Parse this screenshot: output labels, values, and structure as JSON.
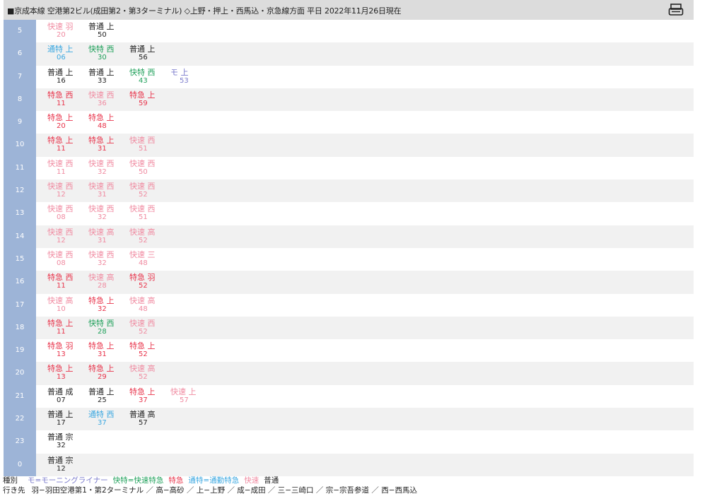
{
  "header": {
    "title": "■京成本線 空港第2ビル(成田第2・第3ターミナル) ◇上野・押上・西馬込・京急線方面 平日 2022年11月26日現在",
    "print_icon": "printer-icon"
  },
  "colors": {
    "moning": "#7b7bcc",
    "kaitoku": "#1fa05a",
    "tokkyu": "#e8334a",
    "tsukin": "#3aa7e0",
    "kaisoku": "#f08aa0",
    "futsu": "#222222",
    "hour_bg": "#9db4d7"
  },
  "rows": [
    {
      "hour": "5",
      "trains": [
        {
          "type": "快速",
          "dest": "羽",
          "min": "20",
          "kind": "kaisoku"
        },
        {
          "type": "普通",
          "dest": "上",
          "min": "50",
          "kind": "futsu"
        }
      ]
    },
    {
      "hour": "6",
      "trains": [
        {
          "type": "通特",
          "dest": "上",
          "min": "06",
          "kind": "tsukin"
        },
        {
          "type": "快特",
          "dest": "西",
          "min": "30",
          "kind": "kaitoku"
        },
        {
          "type": "普通",
          "dest": "上",
          "min": "56",
          "kind": "futsu"
        }
      ]
    },
    {
      "hour": "7",
      "trains": [
        {
          "type": "普通",
          "dest": "上",
          "min": "16",
          "kind": "futsu"
        },
        {
          "type": "普通",
          "dest": "上",
          "min": "33",
          "kind": "futsu"
        },
        {
          "type": "快特",
          "dest": "西",
          "min": "43",
          "kind": "kaitoku"
        },
        {
          "type": "モ",
          "dest": "上",
          "min": "53",
          "kind": "moning"
        }
      ]
    },
    {
      "hour": "8",
      "trains": [
        {
          "type": "特急",
          "dest": "西",
          "min": "11",
          "kind": "tokkyu"
        },
        {
          "type": "快速",
          "dest": "西",
          "min": "36",
          "kind": "kaisoku"
        },
        {
          "type": "特急",
          "dest": "上",
          "min": "59",
          "kind": "tokkyu"
        }
      ]
    },
    {
      "hour": "9",
      "trains": [
        {
          "type": "特急",
          "dest": "上",
          "min": "20",
          "kind": "tokkyu"
        },
        {
          "type": "特急",
          "dest": "上",
          "min": "48",
          "kind": "tokkyu"
        }
      ]
    },
    {
      "hour": "10",
      "trains": [
        {
          "type": "特急",
          "dest": "上",
          "min": "11",
          "kind": "tokkyu"
        },
        {
          "type": "特急",
          "dest": "上",
          "min": "31",
          "kind": "tokkyu"
        },
        {
          "type": "快速",
          "dest": "西",
          "min": "51",
          "kind": "kaisoku"
        }
      ]
    },
    {
      "hour": "11",
      "trains": [
        {
          "type": "快速",
          "dest": "西",
          "min": "11",
          "kind": "kaisoku"
        },
        {
          "type": "快速",
          "dest": "西",
          "min": "32",
          "kind": "kaisoku"
        },
        {
          "type": "快速",
          "dest": "西",
          "min": "50",
          "kind": "kaisoku"
        }
      ]
    },
    {
      "hour": "12",
      "trains": [
        {
          "type": "快速",
          "dest": "西",
          "min": "12",
          "kind": "kaisoku"
        },
        {
          "type": "快速",
          "dest": "西",
          "min": "31",
          "kind": "kaisoku"
        },
        {
          "type": "快速",
          "dest": "西",
          "min": "52",
          "kind": "kaisoku"
        }
      ]
    },
    {
      "hour": "13",
      "trains": [
        {
          "type": "快速",
          "dest": "西",
          "min": "08",
          "kind": "kaisoku"
        },
        {
          "type": "快速",
          "dest": "西",
          "min": "32",
          "kind": "kaisoku"
        },
        {
          "type": "快速",
          "dest": "西",
          "min": "51",
          "kind": "kaisoku"
        }
      ]
    },
    {
      "hour": "14",
      "trains": [
        {
          "type": "快速",
          "dest": "西",
          "min": "12",
          "kind": "kaisoku"
        },
        {
          "type": "快速",
          "dest": "高",
          "min": "31",
          "kind": "kaisoku"
        },
        {
          "type": "快速",
          "dest": "高",
          "min": "52",
          "kind": "kaisoku"
        }
      ]
    },
    {
      "hour": "15",
      "trains": [
        {
          "type": "快速",
          "dest": "西",
          "min": "08",
          "kind": "kaisoku"
        },
        {
          "type": "快速",
          "dest": "西",
          "min": "32",
          "kind": "kaisoku"
        },
        {
          "type": "快速",
          "dest": "三",
          "min": "48",
          "kind": "kaisoku"
        }
      ]
    },
    {
      "hour": "16",
      "trains": [
        {
          "type": "特急",
          "dest": "西",
          "min": "11",
          "kind": "tokkyu"
        },
        {
          "type": "快速",
          "dest": "高",
          "min": "28",
          "kind": "kaisoku"
        },
        {
          "type": "特急",
          "dest": "羽",
          "min": "52",
          "kind": "tokkyu"
        }
      ]
    },
    {
      "hour": "17",
      "trains": [
        {
          "type": "快速",
          "dest": "高",
          "min": "10",
          "kind": "kaisoku"
        },
        {
          "type": "特急",
          "dest": "上",
          "min": "32",
          "kind": "tokkyu"
        },
        {
          "type": "快速",
          "dest": "高",
          "min": "48",
          "kind": "kaisoku"
        }
      ]
    },
    {
      "hour": "18",
      "trains": [
        {
          "type": "特急",
          "dest": "上",
          "min": "11",
          "kind": "tokkyu"
        },
        {
          "type": "快特",
          "dest": "西",
          "min": "28",
          "kind": "kaitoku"
        },
        {
          "type": "快速",
          "dest": "西",
          "min": "52",
          "kind": "kaisoku"
        }
      ]
    },
    {
      "hour": "19",
      "trains": [
        {
          "type": "特急",
          "dest": "羽",
          "min": "13",
          "kind": "tokkyu"
        },
        {
          "type": "特急",
          "dest": "上",
          "min": "31",
          "kind": "tokkyu"
        },
        {
          "type": "特急",
          "dest": "上",
          "min": "52",
          "kind": "tokkyu"
        }
      ]
    },
    {
      "hour": "20",
      "trains": [
        {
          "type": "特急",
          "dest": "上",
          "min": "13",
          "kind": "tokkyu"
        },
        {
          "type": "特急",
          "dest": "上",
          "min": "29",
          "kind": "tokkyu"
        },
        {
          "type": "快速",
          "dest": "高",
          "min": "52",
          "kind": "kaisoku"
        }
      ]
    },
    {
      "hour": "21",
      "trains": [
        {
          "type": "普通",
          "dest": "成",
          "min": "07",
          "kind": "futsu"
        },
        {
          "type": "普通",
          "dest": "上",
          "min": "25",
          "kind": "futsu"
        },
        {
          "type": "特急",
          "dest": "上",
          "min": "37",
          "kind": "tokkyu"
        },
        {
          "type": "快速",
          "dest": "上",
          "min": "57",
          "kind": "kaisoku"
        }
      ]
    },
    {
      "hour": "22",
      "trains": [
        {
          "type": "普通",
          "dest": "上",
          "min": "17",
          "kind": "futsu"
        },
        {
          "type": "通特",
          "dest": "西",
          "min": "37",
          "kind": "tsukin"
        },
        {
          "type": "普通",
          "dest": "高",
          "min": "57",
          "kind": "futsu"
        }
      ]
    },
    {
      "hour": "23",
      "trains": [
        {
          "type": "普通",
          "dest": "宗",
          "min": "32",
          "kind": "futsu"
        }
      ]
    },
    {
      "hour": "0",
      "trains": [
        {
          "type": "普通",
          "dest": "宗",
          "min": "12",
          "kind": "futsu"
        }
      ]
    }
  ],
  "legend": {
    "type_heading": "種別",
    "type_items": [
      {
        "text": "モ=モーニングライナー",
        "kind": "moning"
      },
      {
        "text": "快特=快速特急",
        "kind": "kaitoku"
      },
      {
        "text": "特急",
        "kind": "tokkyu"
      },
      {
        "text": "通特=通勤特急",
        "kind": "tsukin"
      },
      {
        "text": "快速",
        "kind": "kaisoku"
      },
      {
        "text": "普通",
        "kind": "futsu"
      }
    ],
    "dest_heading": "行き先",
    "dest_text": "羽−羽田空港第1・第2ターミナル ／ 高−高砂 ／ 上−上野 ／ 成−成田 ／ 三−三崎口 ／ 宗−宗吾参道 ／ 西−西馬込"
  }
}
